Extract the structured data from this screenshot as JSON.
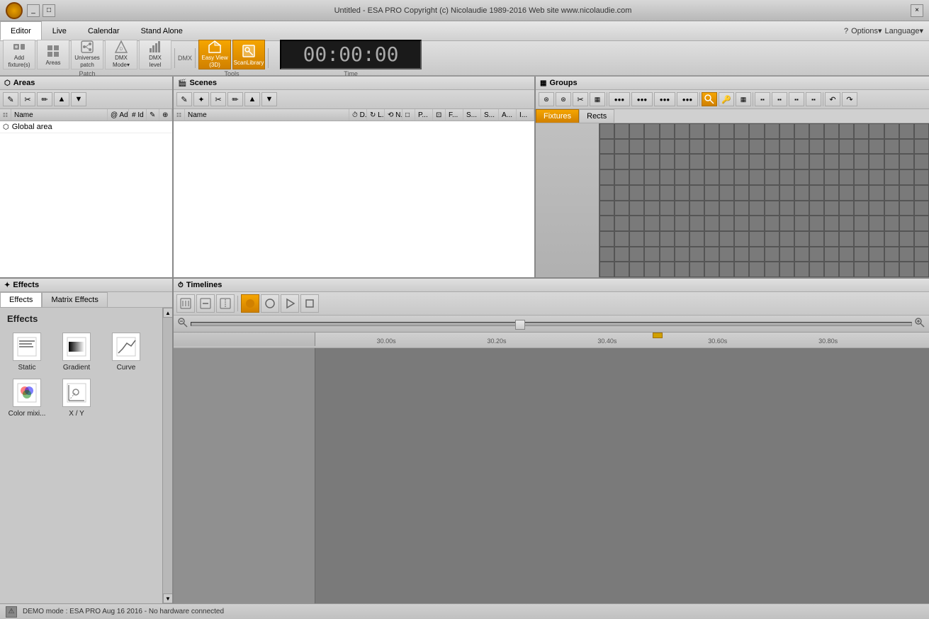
{
  "titlebar": {
    "title": "Untitled - ESA PRO    Copyright (c) Nicolaudie 1989-2016    Web site www.nicolaudie.com",
    "controls": [
      "_",
      "□",
      "×"
    ]
  },
  "menubar": {
    "tabs": [
      "Editor",
      "Live",
      "Calendar",
      "Stand Alone"
    ],
    "active_tab": "Editor",
    "right_items": [
      "?",
      "Options",
      "Language"
    ]
  },
  "toolbar": {
    "groups": [
      {
        "name": "Patch",
        "buttons": [
          {
            "id": "add-fixture",
            "label": "Add\nfixture(s)",
            "icon": "➕"
          },
          {
            "id": "areas",
            "label": "Areas",
            "icon": "▦"
          },
          {
            "id": "universes-patch",
            "label": "Universes\npatch",
            "icon": "🔲"
          },
          {
            "id": "dmx-mode",
            "label": "DMX\nMode▼",
            "icon": "⬡"
          },
          {
            "id": "dmx-level",
            "label": "DMX\nlevel",
            "icon": "📊"
          }
        ]
      },
      {
        "name": "Tools",
        "buttons": [
          {
            "id": "easy-view",
            "label": "Easy View\n(3D)",
            "icon": "⬡",
            "active": true
          },
          {
            "id": "scanlibrary",
            "label": "ScanLibrary",
            "icon": "📚",
            "active": true
          }
        ]
      }
    ],
    "time": "00:00:00",
    "time_group_label": "Time"
  },
  "areas": {
    "header": "Areas",
    "columns": [
      "Name",
      "Adr.",
      "Id",
      "",
      ""
    ],
    "rows": [
      {
        "name": "Global area"
      }
    ],
    "toolbar_icons": [
      "✎",
      "✂",
      "✏",
      "▲",
      "▼"
    ]
  },
  "scenes": {
    "header": "Scenes",
    "columns": [
      "Name",
      "D...",
      "L...",
      "N...",
      "",
      "P...",
      "",
      "F...",
      "S...",
      "S...",
      "A...",
      "I..."
    ],
    "toolbar_icons": [
      "✎",
      "✦",
      "✂",
      "✏",
      "▲",
      "▼"
    ]
  },
  "groups": {
    "header": "Groups",
    "tabs": [
      "Fixtures",
      "Rects"
    ],
    "active_tab": "Fixtures",
    "toolbar_icons": [
      "⊛",
      "⊛",
      "✂",
      "▦",
      "●●●",
      "●●●",
      "●●●",
      "●●●",
      "●●●",
      "🔍",
      "🔑",
      "▦",
      "▪▪",
      "▪▪",
      "▪▪",
      "▪▪",
      "↶",
      "↷"
    ]
  },
  "effects": {
    "header": "Effects",
    "tabs": [
      "Effects",
      "Matrix Effects"
    ],
    "active_tab": "Effects",
    "title": "Effects",
    "items": [
      {
        "id": "static",
        "label": "Static",
        "icon": "📄"
      },
      {
        "id": "gradient",
        "label": "Gradient",
        "icon": "📄"
      },
      {
        "id": "curve",
        "label": "Curve",
        "icon": "📈"
      },
      {
        "id": "color-mixing",
        "label": "Color mixi...",
        "icon": "📄"
      },
      {
        "id": "xy",
        "label": "X / Y",
        "icon": "📄"
      }
    ]
  },
  "timelines": {
    "header": "Timelines",
    "toolbar_icons": [
      "⊞",
      "⊟",
      "⊠",
      "⏺",
      "⏹",
      "▶",
      "⏹"
    ],
    "play_active": "⏺",
    "ruler_marks": [
      "30.00s",
      "30.20s",
      "30.40s",
      "30.60s",
      "30.80s"
    ],
    "zoom_label": "🔍"
  },
  "statusbar": {
    "text": "DEMO mode : ESA PRO Aug 16 2016 - No hardware connected",
    "icon": "⚠"
  }
}
